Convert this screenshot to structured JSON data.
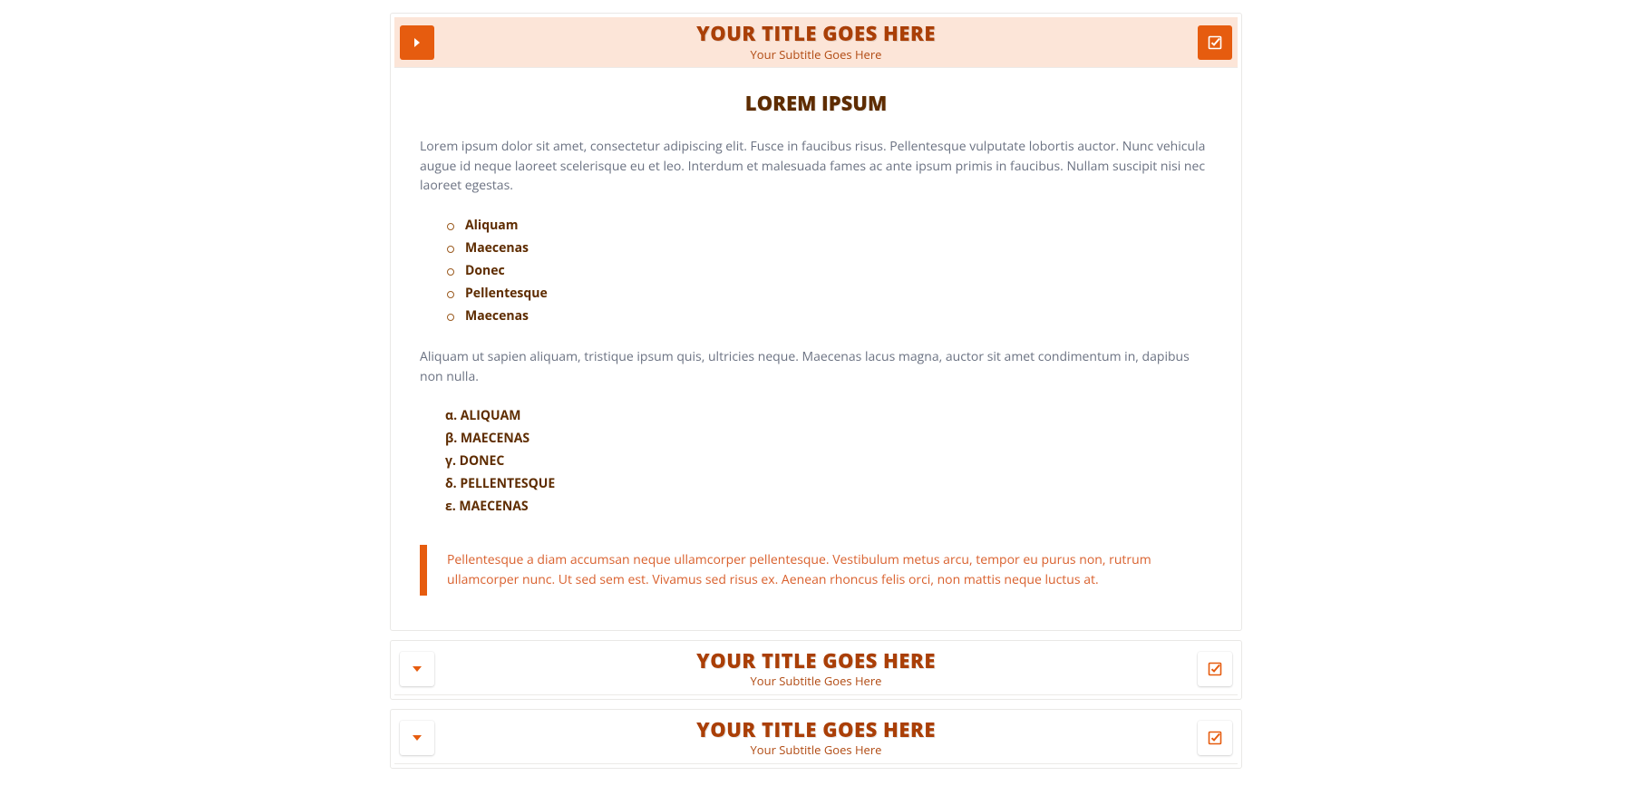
{
  "colors": {
    "accent": "#e65c0f",
    "title": "#aa3f07",
    "bodyHeading": "#5e2c00"
  },
  "panels": [
    {
      "open": true,
      "title": "YOUR TITLE GOES HERE",
      "subtitle": "Your Subtitle Goes Here",
      "content": {
        "heading": "LOREM IPSUM",
        "p1": "Lorem ipsum dolor sit amet, consectetur adipiscing elit. Fusce in faucibus risus. Pellentesque vulputate lobortis auctor. Nunc vehicula augue id neque laoreet scelerisque eu et leo. Interdum et malesuada fames ac ante ipsum primis in faucibus. Nullam suscipit nisi nec laoreet egestas.",
        "bullets": [
          "Aliquam",
          "Maecenas",
          "Donec",
          "Pellentesque",
          "Maecenas"
        ],
        "p2": "Aliquam ut sapien aliquam, tristique ipsum quis, ultricies neque. Maecenas lacus magna, auctor sit amet condimentum in, dapibus non nulla.",
        "greek_markers": [
          "α",
          "β",
          "γ",
          "δ",
          "ε"
        ],
        "greek_items": [
          "ALIQUAM",
          "MAECENAS",
          "DONEC",
          "PELLENTESQUE",
          "MAECENAS"
        ],
        "quote": "Pellentesque a diam accumsan neque ullamcorper pellentesque. Vestibulum metus arcu, tempor eu purus non, rutrum ullamcorper nunc. Ut sed sem est. Vivamus sed risus ex. Aenean rhoncus felis orci, non mattis neque luctus at."
      }
    },
    {
      "open": false,
      "title": "YOUR TITLE GOES HERE",
      "subtitle": "Your Subtitle Goes Here"
    },
    {
      "open": false,
      "title": "YOUR TITLE GOES HERE",
      "subtitle": "Your Subtitle Goes Here"
    }
  ]
}
